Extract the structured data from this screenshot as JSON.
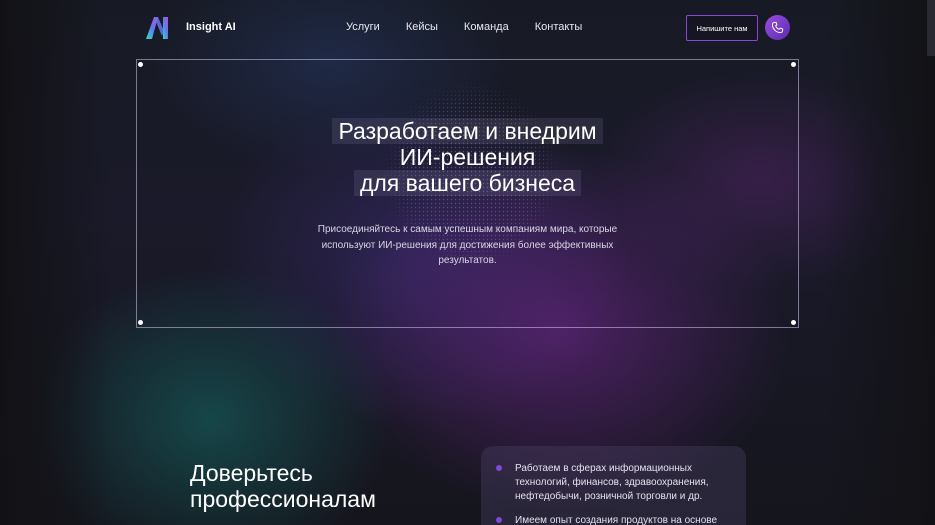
{
  "header": {
    "brand": "Insight AI",
    "nav": [
      "Услуги",
      "Кейсы",
      "Команда",
      "Контакты"
    ],
    "cta_label": "Напишите нам",
    "phone_icon": "phone-icon",
    "logo_icon": "insight-ai-logo"
  },
  "hero": {
    "title_lines": [
      "Разработаем и внедрим",
      "ИИ-решения",
      "для вашего бизнеса"
    ],
    "subtitle": "Присоединяйтесь к самым успешным компаниям мира, которые используют ИИ-решения для достижения более эффективных результатов."
  },
  "section": {
    "title_lines": [
      "Доверьтесь",
      "профессионалам"
    ],
    "items": [
      "Работаем в сферах информационных технологий, финансов, здравоохранения, нефтедобычи, розничной торговли и др.",
      "Имеем опыт создания продуктов на основе"
    ]
  },
  "colors": {
    "accent": "#8a46d8",
    "bullet": "#7c4ad6",
    "background": "#15151d"
  }
}
